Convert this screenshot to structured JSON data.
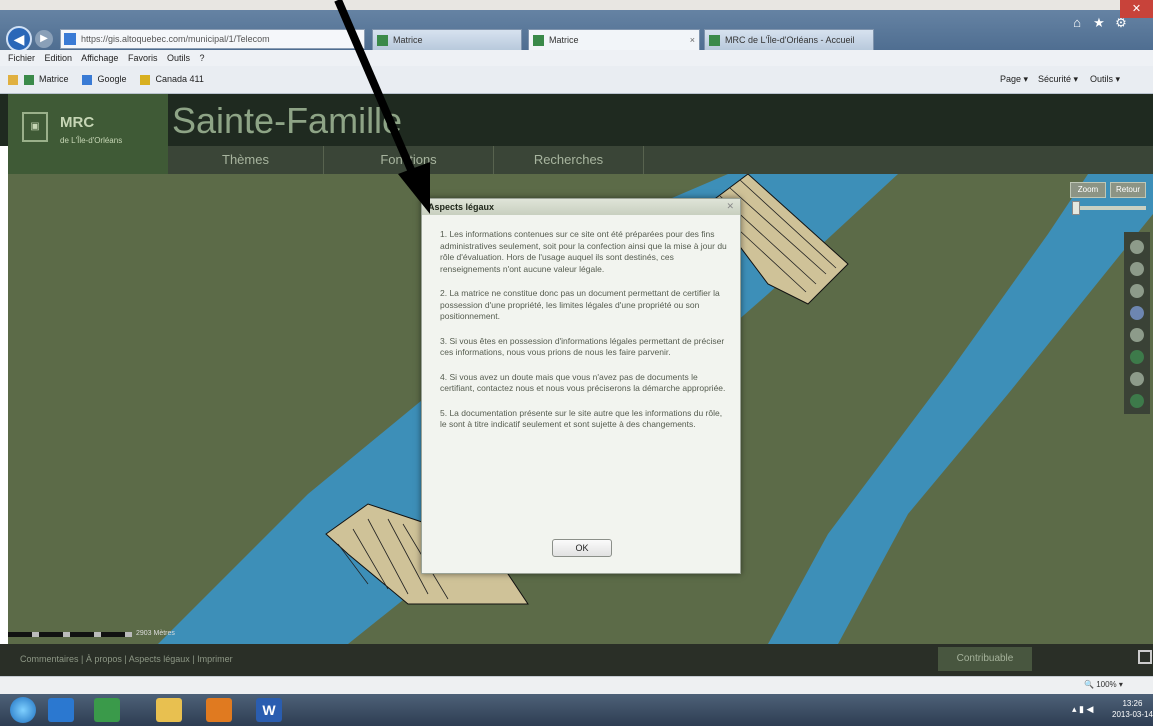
{
  "browser": {
    "address": "https://gis.altoquebec.com/municipal/1/Telecom",
    "tabs": [
      "Matrice",
      "Matrice",
      "MRC de L'Île-d'Orléans - Accueil"
    ],
    "menu": [
      "Fichier",
      "Edition",
      "Affichage",
      "Favoris",
      "Outils",
      "?"
    ],
    "favorites": [
      "Matrice",
      "Google",
      "Canada 411"
    ],
    "commands": [
      "Page ▾",
      "Sécurité ▾",
      "Outils ▾"
    ],
    "zoom": "100%"
  },
  "app": {
    "logo_title": "MRC",
    "logo_subtitle": "de L'Île-d'Orléans",
    "page_title": "Sainte-Famille",
    "tabs": [
      "Thèmes",
      "Fonctions",
      "Recherches"
    ],
    "zoom_buttons": [
      "Zoom",
      "Retour"
    ],
    "scale_label": "2903 Mètres",
    "footer_links": "Commentaires  |  À propos  |  Aspects légaux  |  Imprimer",
    "contrib_button": "Contribuable"
  },
  "dialog": {
    "title": "Aspects légaux",
    "paragraphs": [
      "1. Les informations contenues sur ce site ont été préparées pour des fins administratives seulement, soit pour la confection ainsi que la mise à jour du rôle d'évaluation. Hors de l'usage auquel ils sont destinés, ces renseignements n'ont aucune valeur légale.",
      "2. La matrice ne constitue donc pas un document permettant de certifier la possession d'une propriété, les limites légales d'une propriété ou son positionnement.",
      "3. Si vous êtes en possession d'informations légales permettant de préciser ces informations, nous vous prions de nous les faire parvenir.",
      "4. Si vous avez un doute mais que vous n'avez pas de documents le certifiant, contactez nous et nous vous préciserons la démarche appropriée.",
      "5. La documentation présente sur le site autre que les informations du rôle, le sont à titre indicatif seulement et sont sujette à des changements."
    ],
    "ok_label": "OK"
  },
  "taskbar": {
    "time": "13:26",
    "date": "2013-03-14"
  }
}
